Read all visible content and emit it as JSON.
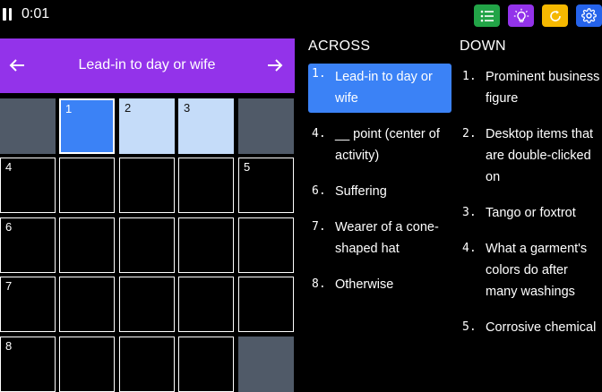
{
  "header": {
    "timer": "0:01",
    "icons": {
      "pause": "pause-icon",
      "list": "list-icon",
      "hint": "lightbulb-icon",
      "reset": "reset-icon",
      "settings": "gear-icon"
    },
    "colors": {
      "list": "#22a447",
      "hint": "#9333ea",
      "reset": "#f5b800",
      "settings": "#2563eb"
    }
  },
  "clue_bar": {
    "current_clue": "Lead-in to day or wife",
    "prev_icon": "arrow-left-icon",
    "next_icon": "arrow-right-icon",
    "color": "#9333ea"
  },
  "grid": {
    "size": 5,
    "rows": [
      [
        "block",
        "1",
        "2",
        "3",
        "block"
      ],
      [
        "4",
        "",
        "",
        "",
        "5"
      ],
      [
        "6",
        "",
        "",
        "",
        ""
      ],
      [
        "7",
        "",
        "",
        "",
        ""
      ],
      [
        "8",
        "",
        "",
        "",
        "block"
      ]
    ],
    "active_cell": [
      0,
      1
    ],
    "highlighted_word_cells": [
      [
        0,
        2
      ],
      [
        0,
        3
      ]
    ]
  },
  "across": {
    "title": "ACROSS",
    "clues": [
      {
        "number": "1.",
        "text": "Lead-in to day or wife",
        "selected": true
      },
      {
        "number": "4.",
        "text": "__ point (center of activity)"
      },
      {
        "number": "6.",
        "text": "Suffering"
      },
      {
        "number": "7.",
        "text": "Wearer of a cone-shaped hat"
      },
      {
        "number": "8.",
        "text": "Otherwise"
      }
    ]
  },
  "down": {
    "title": "DOWN",
    "clues": [
      {
        "number": "1.",
        "text": "Prominent business figure"
      },
      {
        "number": "2.",
        "text": "Desktop items that are double-clicked on"
      },
      {
        "number": "3.",
        "text": "Tango or foxtrot"
      },
      {
        "number": "4.",
        "text": "What a garment's colors do after many washings"
      },
      {
        "number": "5.",
        "text": "Corrosive chemical"
      }
    ]
  }
}
